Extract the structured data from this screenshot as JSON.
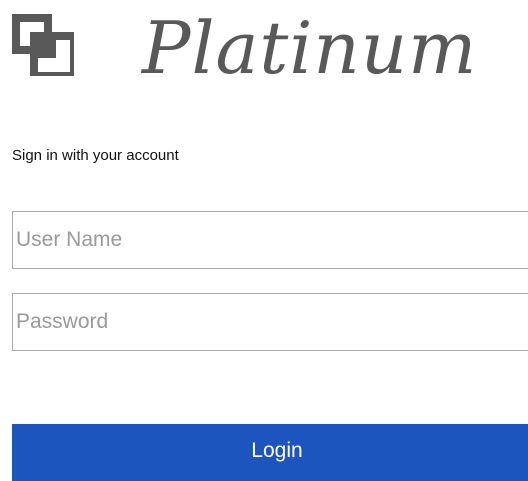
{
  "brand": {
    "name": "Platinum",
    "logo_icon": "overlapping-squares-icon",
    "text_color": "#595959"
  },
  "form": {
    "subtitle": "Sign in with your account",
    "username_placeholder": "User Name",
    "password_placeholder": "Password",
    "login_label": "Login"
  },
  "colors": {
    "primary": "#1d55bf",
    "input_border": "#a9a9a9",
    "placeholder": "#9a9a9a"
  }
}
